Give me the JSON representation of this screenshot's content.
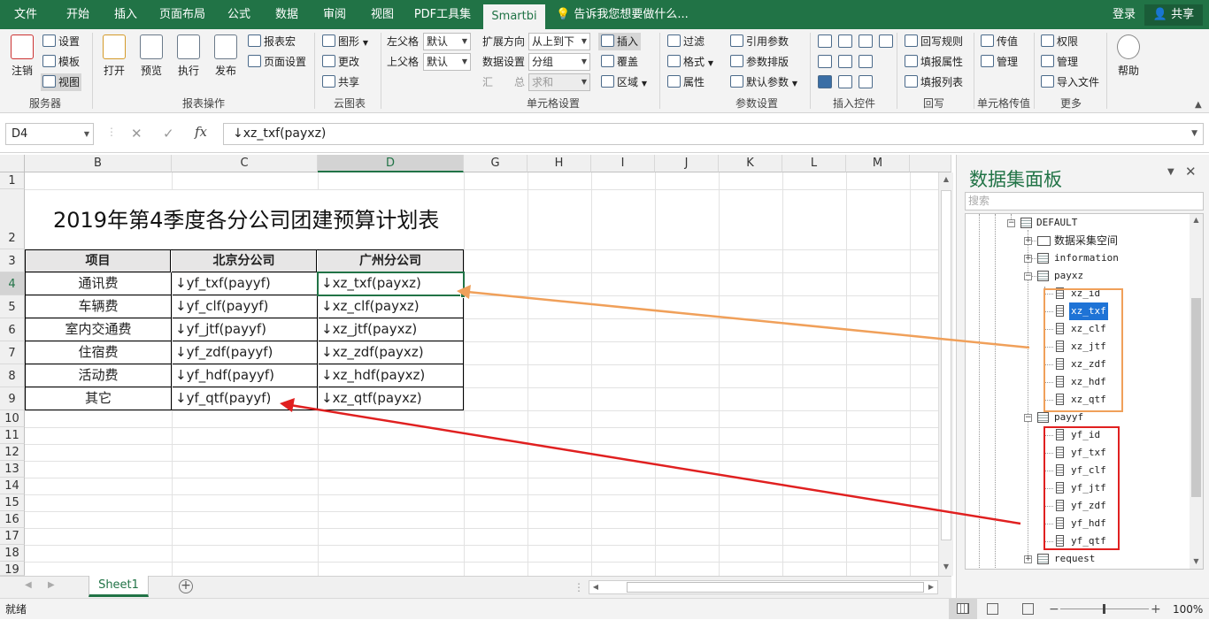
{
  "tabs": [
    {
      "label": "文件",
      "active": false
    },
    {
      "label": "开始",
      "active": false
    },
    {
      "label": "插入",
      "active": false
    },
    {
      "label": "页面布局",
      "active": false
    },
    {
      "label": "公式",
      "active": false
    },
    {
      "label": "数据",
      "active": false
    },
    {
      "label": "审阅",
      "active": false
    },
    {
      "label": "视图",
      "active": false
    },
    {
      "label": "PDF工具集",
      "active": false
    },
    {
      "label": "Smartbi",
      "active": true
    }
  ],
  "tell_me": "告诉我您想要做什么...",
  "account": {
    "login": "登录",
    "share": "共享"
  },
  "ribbon": {
    "server": {
      "label": "服务器",
      "logout": "注销",
      "settings": "设置",
      "template": "模板",
      "view": "视图"
    },
    "report": {
      "label": "报表操作",
      "open": "打开",
      "preview": "预览",
      "execute": "执行",
      "publish": "发布",
      "macro": "报表宏",
      "page_setup": "页面设置"
    },
    "cloud": {
      "label": "云图表",
      "graph": "图形",
      "change": "更改",
      "share": "共享"
    },
    "cell": {
      "label": "单元格设置",
      "left_parent": "左父格",
      "top_parent": "上父格",
      "left_value": "默认",
      "top_value": "默认",
      "expand_dir": "扩展方向",
      "expand_value": "从上到下",
      "data_setting": "数据设置",
      "data_value": "分组",
      "summary": "汇　　总",
      "summary_value": "求和",
      "insert": "插入",
      "cover": "覆盖",
      "area": "区域"
    },
    "param": {
      "label": "参数设置",
      "filter": "过滤",
      "format": "格式",
      "property": "属性",
      "ref_param": "引用参数",
      "param_layout": "参数排版",
      "default_param": "默认参数"
    },
    "controls": {
      "label": "插入控件"
    },
    "writeback": {
      "label": "回写",
      "rule": "回写规则",
      "fill_prop": "填报属性",
      "fill_list": "填报列表"
    },
    "cellpass": {
      "label": "单元格传值",
      "pass": "传值",
      "manage": "管理"
    },
    "more": {
      "label": "更多",
      "permission": "权限",
      "manage": "管理",
      "import": "导入文件",
      "help": "帮助"
    }
  },
  "formula_bar": {
    "namebox": "D4",
    "cancel": "✕",
    "confirm": "✓",
    "fx": "fx",
    "formula": "↓xz_txf(payxz)"
  },
  "columns": [
    "B",
    "C",
    "D",
    "G",
    "H",
    "I",
    "J",
    "K",
    "L",
    "M"
  ],
  "rows": [
    "1",
    "2",
    "3",
    "4",
    "5",
    "6",
    "7",
    "8",
    "9",
    "10",
    "11",
    "12",
    "13",
    "14",
    "15",
    "16",
    "17",
    "18",
    "19"
  ],
  "sheet": {
    "title": "2019年第4季度各分公司团建预算计划表",
    "headers": [
      "项目",
      "北京分公司",
      "广州分公司"
    ],
    "data": [
      [
        "通讯费",
        "↓yf_txf(payyf)",
        "↓xz_txf(payxz)"
      ],
      [
        "车辆费",
        "↓yf_clf(payyf)",
        "↓xz_clf(payxz)"
      ],
      [
        "室内交通费",
        "↓yf_jtf(payyf)",
        "↓xz_jtf(payxz)"
      ],
      [
        "住宿费",
        "↓yf_zdf(payyf)",
        "↓xz_zdf(payxz)"
      ],
      [
        "活动费",
        "↓yf_hdf(payyf)",
        "↓xz_hdf(payxz)"
      ],
      [
        "其它",
        "↓yf_qtf(payyf)",
        "↓xz_qtf(payxz)"
      ]
    ]
  },
  "sheet_tab": "Sheet1",
  "status": {
    "ready": "就绪",
    "zoom": "100%"
  },
  "panel": {
    "title": "数据集面板",
    "search_placeholder": "搜索",
    "tree": {
      "root": "DEFAULT",
      "folder": "数据采集空间",
      "info": "information",
      "payxz": "payxz",
      "payxz_fields": [
        "xz_id",
        "xz_txf",
        "xz_clf",
        "xz_jtf",
        "xz_zdf",
        "xz_hdf",
        "xz_qtf"
      ],
      "payyf": "payyf",
      "payyf_fields": [
        "yf_id",
        "yf_txf",
        "yf_clf",
        "yf_jtf",
        "yf_zdf",
        "yf_hdf",
        "yf_qtf"
      ],
      "request": "request"
    }
  },
  "colors": {
    "brand": "#217346",
    "selection": "#1e73d6",
    "orange_arrow": "#f0a05a",
    "red_arrow": "#e02020"
  }
}
